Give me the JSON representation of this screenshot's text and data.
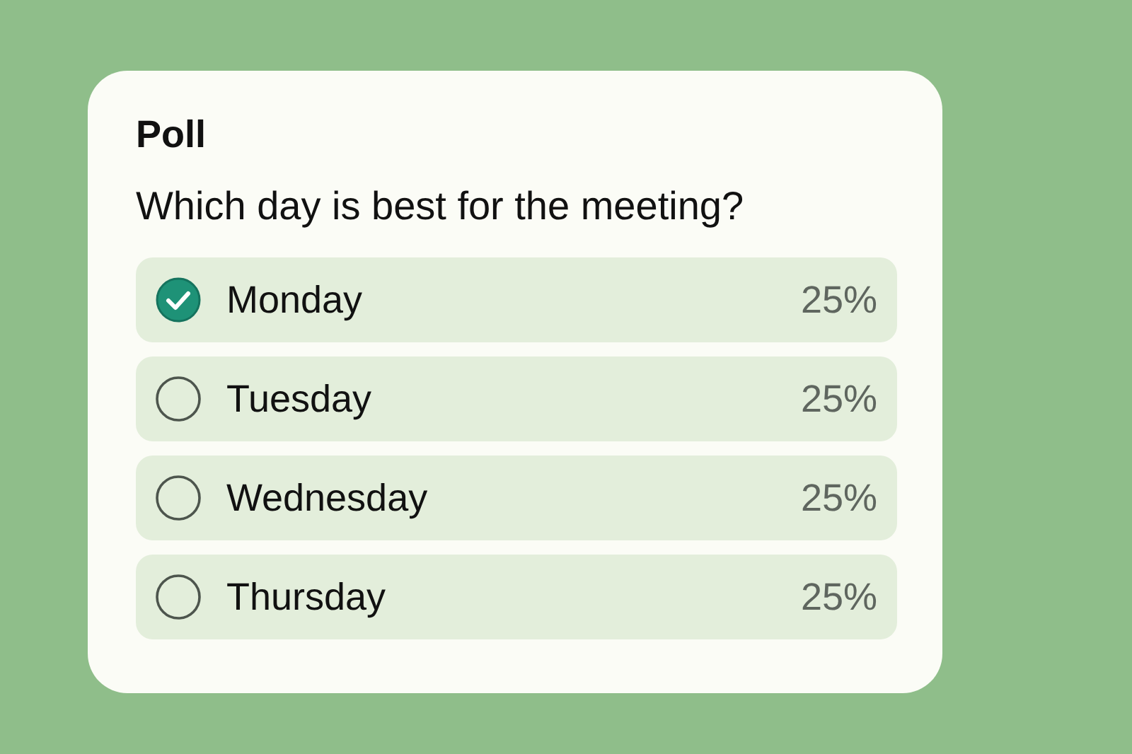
{
  "poll": {
    "title": "Poll",
    "question": "Which day is best for the meeting?",
    "options": [
      {
        "label": "Monday",
        "percent": "25%",
        "selected": true
      },
      {
        "label": "Tuesday",
        "percent": "25%",
        "selected": false
      },
      {
        "label": "Wednesday",
        "percent": "25%",
        "selected": false
      },
      {
        "label": "Thursday",
        "percent": "25%",
        "selected": false
      }
    ]
  }
}
